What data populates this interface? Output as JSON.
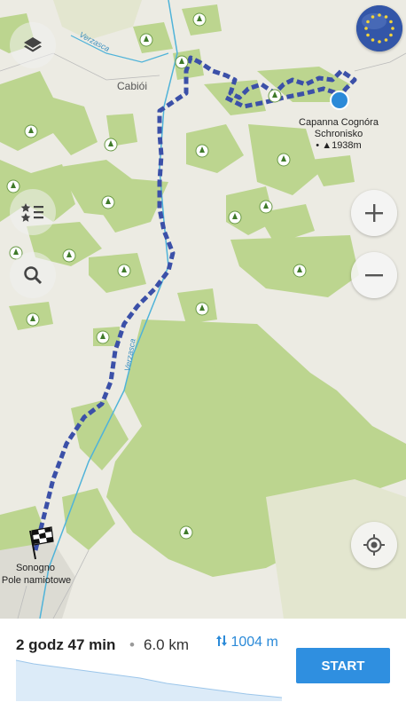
{
  "map": {
    "place_labels": {
      "town": "Cabiói",
      "hut_name": "Capanna Cognóra",
      "hut_type": "Schronisko",
      "hut_elev": "• ▲1938m",
      "start_name": "Sonogno",
      "start_type": "Pole namiotowe"
    },
    "river_labels": {
      "top": "Verzasca",
      "mid": "Verzasca"
    },
    "icons": {
      "layers": "layers-icon",
      "favorites": "favorites-list-icon",
      "search": "search-icon",
      "zoom_in": "plus-icon",
      "zoom_out": "minus-icon",
      "locate": "locate-icon",
      "region": "eu-flag-icon",
      "finish": "checkered-flag-icon"
    },
    "colors": {
      "route": "#3b50a8",
      "forest": "#b8d48c",
      "river": "#4fb3d9",
      "location": "#2b8ad8"
    }
  },
  "route_summary": {
    "duration": "2 godz 47 min",
    "separator": "•",
    "distance": "6.0 km",
    "elevation": "1004 m",
    "start_label": "START"
  }
}
